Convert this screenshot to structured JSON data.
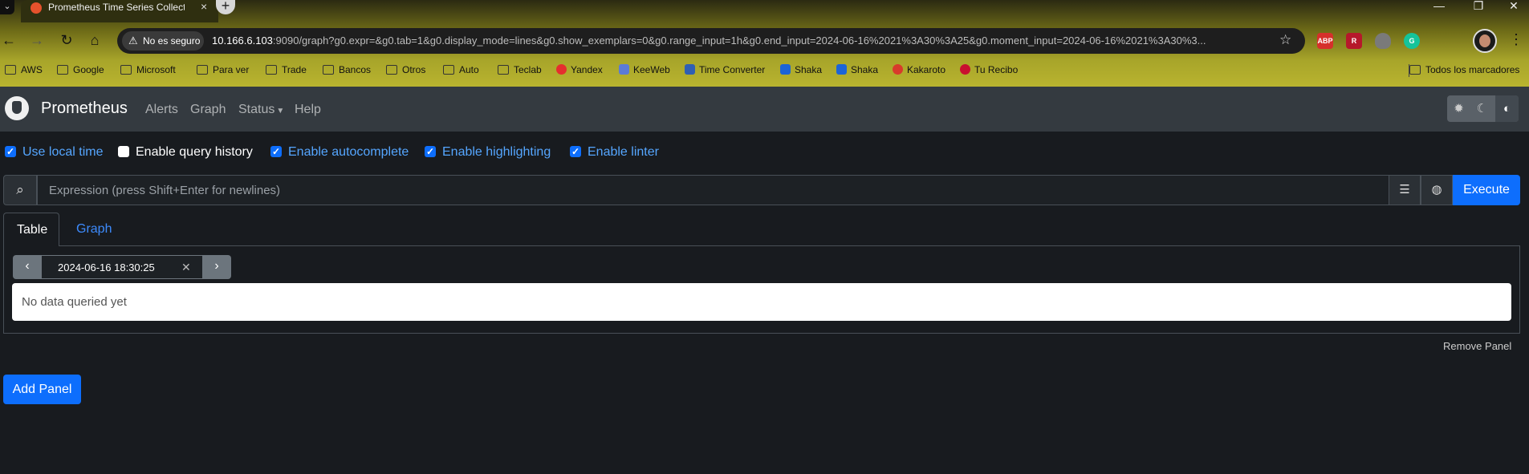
{
  "browser": {
    "tab_title": "Prometheus Time Series Collect",
    "tab_close": "×",
    "new_tab": "+",
    "security_label": "No es seguro",
    "url_host": "10.166.6.103",
    "url_rest": ":9090/graph?g0.expr=&g0.tab=1&g0.display_mode=lines&g0.show_exemplars=0&g0.range_input=1h&g0.end_input=2024-06-16%2021%3A30%3A25&g0.moment_input=2024-06-16%2021%3A30%3...",
    "extensions": [
      "ABP",
      "R",
      "",
      "G",
      ""
    ],
    "bookmarks": [
      "AWS",
      "Google",
      "Microsoft",
      "Para ver",
      "Trade",
      "Bancos",
      "Otros",
      "Auto",
      "Teclab",
      "Yandex",
      "KeeWeb",
      "Time Converter",
      "Shaka",
      "Shaka",
      "Kakaroto",
      "Tu Recibo"
    ],
    "all_bookmarks": "Todos los marcadores"
  },
  "navbar": {
    "brand": "Prometheus",
    "alerts": "Alerts",
    "graph": "Graph",
    "status": "Status",
    "help": "Help"
  },
  "options": {
    "local_time": "Use local time",
    "query_history": "Enable query history",
    "autocomplete": "Enable autocomplete",
    "highlighting": "Enable highlighting",
    "linter": "Enable linter"
  },
  "expression": {
    "placeholder": "Expression (press Shift+Enter for newlines)",
    "execute": "Execute"
  },
  "panel": {
    "tab_table": "Table",
    "tab_graph": "Graph",
    "eval_time": "2024-06-16 18:30:25",
    "no_data": "No data queried yet",
    "remove": "Remove Panel"
  },
  "add_panel": "Add Panel",
  "colors": {
    "primary": "#0d6efd",
    "navbar": "#343a40",
    "background": "#181b1f"
  }
}
